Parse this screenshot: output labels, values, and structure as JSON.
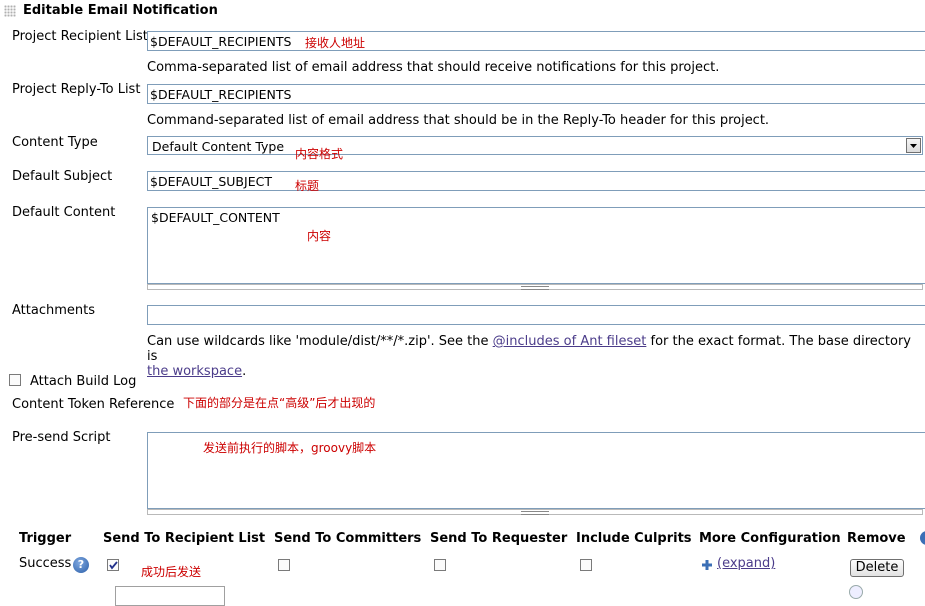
{
  "section": {
    "title": "Editable Email Notification"
  },
  "fields": {
    "recipient": {
      "label": "Project Recipient List",
      "value": "$DEFAULT_RECIPIENTS",
      "annotation": "接收人地址",
      "help": "Comma-separated list of email address that should receive notifications for this project."
    },
    "reply_to": {
      "label": "Project Reply-To List",
      "value": "$DEFAULT_RECIPIENTS",
      "help": "Command-separated list of email address that should be in the Reply-To header for this project."
    },
    "content_type": {
      "label": "Content Type",
      "value": "Default Content Type",
      "annotation": "内容格式"
    },
    "subject": {
      "label": "Default Subject",
      "value": "$DEFAULT_SUBJECT",
      "annotation": "标题"
    },
    "content": {
      "label": "Default Content",
      "value": "$DEFAULT_CONTENT",
      "annotation": "内容"
    },
    "attachments": {
      "label": "Attachments",
      "value": "",
      "help_pre": "Can use wildcards like 'module/dist/**/*.zip'. See the ",
      "help_link1": "@includes of Ant fileset",
      "help_mid": " for the exact format. The base directory is",
      "help_link2": "the workspace",
      "help_post": "."
    },
    "attach_build_log": {
      "label": "Attach Build Log",
      "checked": false
    },
    "token_ref": {
      "label": "Content Token Reference",
      "annotation": "下面的部分是在点“高级”后才出现的"
    },
    "presend": {
      "label": "Pre-send Script",
      "annotation": "发送前执行的脚本，groovy脚本"
    }
  },
  "trigger_table": {
    "headers": [
      "Trigger",
      "Send To Recipient List",
      "Send To Committers",
      "Send To Requester",
      "Include Culprits",
      "More Configuration",
      "Remove"
    ],
    "rows": [
      {
        "trigger": "Success",
        "send_to_recipient": true,
        "send_to_committers": false,
        "send_to_requester": false,
        "include_culprits": false,
        "annotation": "成功后发送",
        "expand_label": "(expand)",
        "remove_label": "Delete"
      }
    ]
  },
  "icons": [
    "grip-icon",
    "dropdown-arrow-icon",
    "help-icon",
    "plus-icon",
    "checkbox-icon"
  ],
  "colors": {
    "annotation": "#cc0000",
    "link": "#4b3c8a",
    "border": "#7f9db9",
    "help_icon": "#3b6fb6"
  }
}
